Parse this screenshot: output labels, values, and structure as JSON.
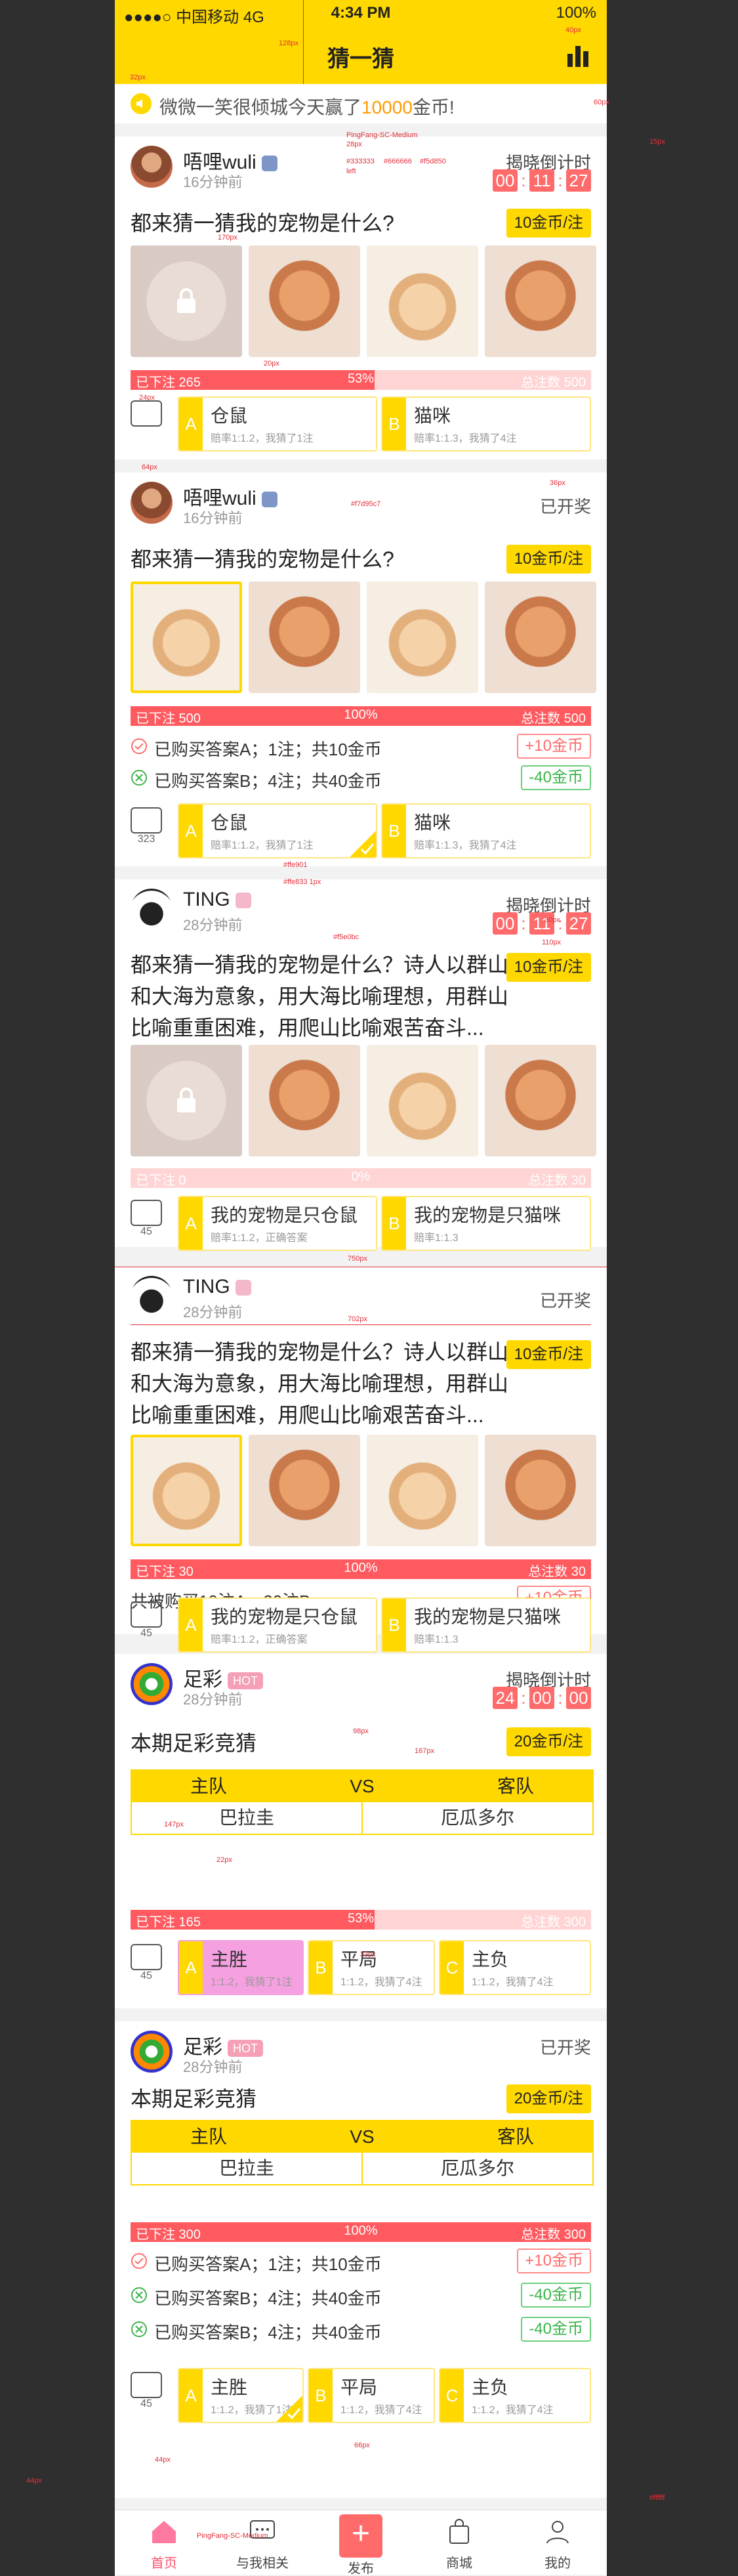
{
  "status_bar": {
    "carrier": "●●●●○ 中国移动 4G",
    "time": "4:34 PM",
    "battery": "100%"
  },
  "nav": {
    "title": "猜一猜"
  },
  "notice": {
    "prefix": "微微一笑很倾城今天赢了",
    "amount": "10000",
    "suffix": "金币!"
  },
  "colors": {
    "brand": "#ffd800",
    "red": "#ff5a5f",
    "pink_light": "#ffd4d4",
    "blue_badge": "#7d95c7",
    "green": "#3bb54a"
  },
  "cards": [
    {
      "user": "唔哩wuli",
      "time": "16分钟前",
      "question": "都来猜一猜我的宠物是什么?",
      "price": "10金币/注",
      "countdown_label": "揭晓倒计时",
      "countdown": [
        "00",
        "11",
        "27"
      ],
      "bar": {
        "left": "已下注 265",
        "mid": "53%",
        "right": "总注数 500",
        "fill": 0.53
      },
      "chat_count": "",
      "options": [
        {
          "letter": "A",
          "name": "仓鼠",
          "sub": "赔率1:1.2，我猜了1注"
        },
        {
          "letter": "B",
          "name": "猫咪",
          "sub": "赔率1:1.3，我猜了4注"
        }
      ]
    },
    {
      "user": "唔哩wuli",
      "time": "16分钟前",
      "question": "都来猜一猜我的宠物是什么?",
      "price": "10金币/注",
      "opened": "已开奖",
      "bar": {
        "left": "已下注 500",
        "mid": "100%",
        "right": "总注数 500",
        "fill": 1.0
      },
      "results": [
        {
          "text": "已购买答案A；1注；共10金币",
          "badge": "+10金币",
          "type": "gain"
        },
        {
          "text": "已购买答案B；4注；共40金币",
          "badge": "-40金币",
          "type": "loss"
        }
      ],
      "chat_count": "323",
      "options": [
        {
          "letter": "A",
          "name": "仓鼠",
          "sub": "赔率1:1.2，我猜了1注"
        },
        {
          "letter": "B",
          "name": "猫咪",
          "sub": "赔率1:1.3，我猜了4注"
        }
      ]
    },
    {
      "user": "TING",
      "time": "28分钟前",
      "question": "都来猜一猜我的宠物是什么？诗人以群山和大海为意象，用大海比喻理想，用群山比喻重重困难，用爬山比喻艰苦奋斗...",
      "price": "10金币/注",
      "countdown_label": "揭晓倒计时",
      "countdown": [
        "00",
        "11",
        "27"
      ],
      "bar": {
        "left": "已下注 0",
        "mid": "0%",
        "right": "总注数 30",
        "fill": 0.0
      },
      "chat_count": "45",
      "options": [
        {
          "letter": "A",
          "name": "我的宠物是只仓鼠",
          "sub": "赔率1:1.2，正确答案"
        },
        {
          "letter": "B",
          "name": "我的宠物是只猫咪",
          "sub": "赔率1:1.3"
        }
      ]
    },
    {
      "user": "TING",
      "time": "28分钟前",
      "question": "都来猜一猜我的宠物是什么？诗人以群山和大海为意象，用大海比喻理想，用群山比喻重重困难，用爬山比喻艰苦奋斗...",
      "price": "10金币/注",
      "opened": "已开奖",
      "bar": {
        "left": "已下注 30",
        "mid": "100%",
        "right": "总注数 30",
        "fill": 1.0
      },
      "summary": "共被购买10注A，20注B",
      "summary_badge": "+10金币",
      "chat_count": "45",
      "options": [
        {
          "letter": "A",
          "name": "我的宠物是只仓鼠",
          "sub": "赔率1:1.2，正确答案"
        },
        {
          "letter": "B",
          "name": "我的宠物是只猫咪",
          "sub": "赔率1:1.3"
        }
      ]
    },
    {
      "user": "足彩",
      "badge": "HOT",
      "time": "28分钟前",
      "question": "本期足彩竞猜",
      "price": "20金币/注",
      "countdown_label": "揭晓倒计时",
      "countdown": [
        "24",
        "00",
        "00"
      ],
      "football": {
        "home_label": "主队",
        "vs": "VS",
        "away_label": "客队",
        "home": "巴拉圭",
        "away": "厄瓜多尔"
      },
      "bar": {
        "left": "已下注 165",
        "mid": "53%",
        "right": "总注数 300",
        "fill": 0.53
      },
      "chat_count": "45",
      "options": [
        {
          "letter": "A",
          "name": "主胜",
          "sub": "1:1.2，我猜了1注"
        },
        {
          "letter": "B",
          "name": "平局",
          "sub": "1:1.2，我猜了4注"
        },
        {
          "letter": "C",
          "name": "主负",
          "sub": "1:1.2，我猜了4注"
        }
      ]
    },
    {
      "user": "足彩",
      "badge": "HOT",
      "time": "28分钟前",
      "question": "本期足彩竞猜",
      "price": "20金币/注",
      "opened": "已开奖",
      "football": {
        "home_label": "主队",
        "vs": "VS",
        "away_label": "客队",
        "home": "巴拉圭",
        "away": "厄瓜多尔"
      },
      "bar": {
        "left": "已下注 300",
        "mid": "100%",
        "right": "总注数 300",
        "fill": 1.0
      },
      "results": [
        {
          "text": "已购买答案A；1注；共10金币",
          "badge": "+10金币",
          "type": "gain"
        },
        {
          "text": "已购买答案B；4注；共40金币",
          "badge": "-40金币",
          "type": "loss"
        },
        {
          "text": "已购买答案B；4注；共40金币",
          "badge": "-40金币",
          "type": "loss"
        }
      ],
      "chat_count": "45",
      "options": [
        {
          "letter": "A",
          "name": "主胜",
          "sub": "1:1.2，我猜了1注"
        },
        {
          "letter": "B",
          "name": "平局",
          "sub": "1:1.2，我猜了4注"
        },
        {
          "letter": "C",
          "name": "主负",
          "sub": "1:1.2，我猜了4注"
        }
      ]
    }
  ],
  "tabbar": [
    {
      "label": "首页",
      "icon": "home-icon"
    },
    {
      "label": "与我相关",
      "icon": "chat-icon"
    },
    {
      "label": "发布",
      "icon": "plus-icon"
    },
    {
      "label": "商城",
      "icon": "bag-icon"
    },
    {
      "label": "我的",
      "icon": "person-icon"
    }
  ],
  "annotations": {
    "a128": "128px",
    "a40": "40px",
    "a32": "32px",
    "a60": "60px",
    "a20": "20px",
    "a28": "28px",
    "a170": "170px",
    "a24": "24px",
    "a64": "64px",
    "a36": "36px",
    "a30": "30px",
    "a15": "15px",
    "a110": "110px",
    "a750": "750px",
    "a702": "702px",
    "a98": "98px",
    "a167": "167px",
    "a147": "147px",
    "a22": "22px",
    "a33": "33px",
    "a44": "44px",
    "a66": "66px",
    "font": "PingFang-SC-Medium",
    "c1": "#333333",
    "c2": "#666666",
    "c3": "#f5d850",
    "c4": "#ffffff",
    "left": "left",
    "fill1": "#f7d95c7",
    "fill2": "#f5e0bc",
    "fill3": "#ffe901",
    "stroke": "#ffe833 1px"
  }
}
